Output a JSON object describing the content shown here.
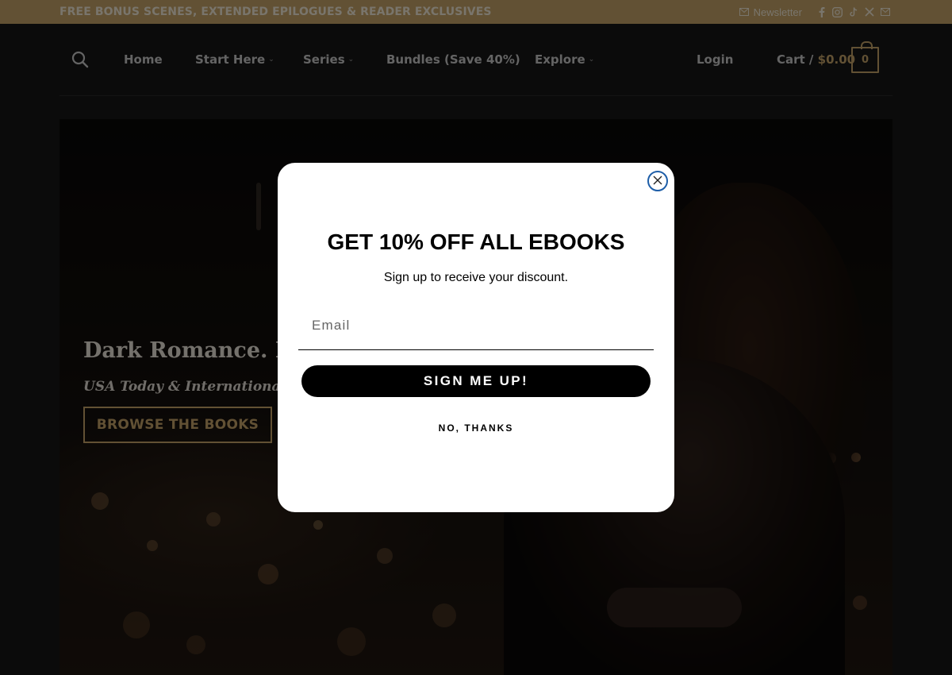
{
  "topbar": {
    "promo": "FREE BONUS SCENES, EXTENDED EPILOGUES & READER EXCLUSIVES",
    "newsletter_label": "Newsletter",
    "social_icons": [
      "facebook-icon",
      "instagram-icon",
      "tiktok-icon",
      "x-icon",
      "email-icon"
    ]
  },
  "header": {
    "nav": [
      {
        "label": "Home",
        "has_dropdown": false
      },
      {
        "label": "Start Here",
        "has_dropdown": true
      },
      {
        "label": "Series",
        "has_dropdown": true
      },
      {
        "label": "Bundles (Save 40%)",
        "has_dropdown": false
      },
      {
        "label": "Explore",
        "has_dropdown": true
      }
    ],
    "login": "Login",
    "cart_label": "Cart /",
    "cart_amount": "$0.00",
    "cart_count": "0"
  },
  "hero": {
    "title": "Dark Romance. Dan",
    "subtitle": "USA Today & International Be",
    "button": "BROWSE THE BOOKS"
  },
  "modal": {
    "title": "GET 10% OFF ALL EBOOKS",
    "subtitle": "Sign up to receive your discount.",
    "email_placeholder": "Email",
    "email_value": "",
    "submit": "SIGN ME UP!",
    "decline": "NO, THANKS"
  },
  "colors": {
    "accent_gold": "#c4a368",
    "page_background": "#161616",
    "modal_background": "#ffffff",
    "button_black": "#000000",
    "close_ring": "#1e5ea8"
  }
}
